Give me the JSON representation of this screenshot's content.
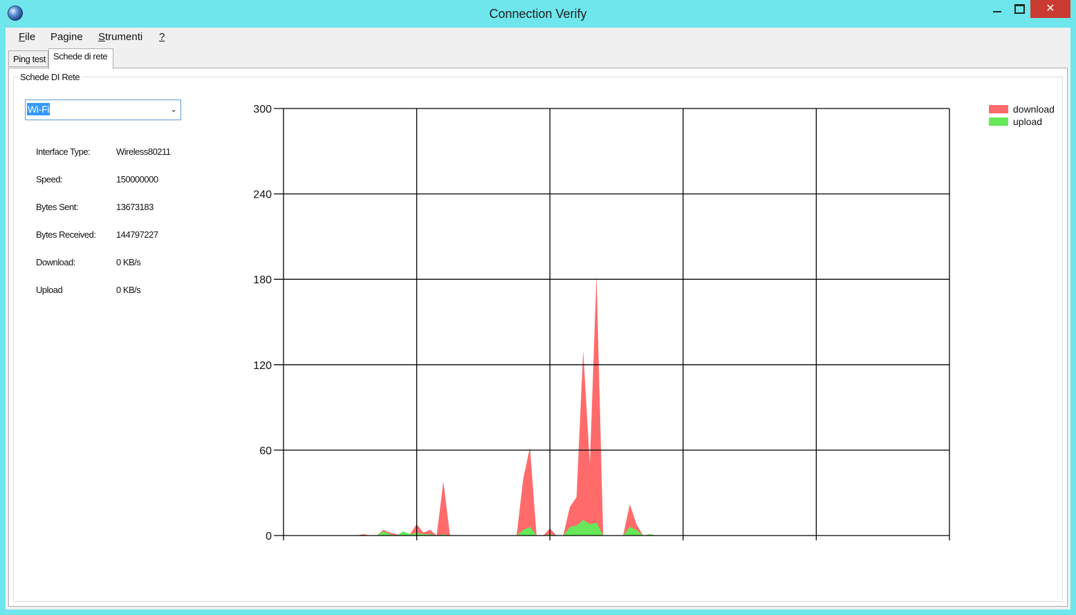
{
  "window": {
    "title": "Connection Verify",
    "close_glyph": "✕"
  },
  "menu": {
    "items": [
      {
        "label": "File",
        "underline": "F",
        "rest": "ile"
      },
      {
        "label": "Pagine",
        "underline": "",
        "rest": "Pagine"
      },
      {
        "label": "Strumenti",
        "underline": "S",
        "rest": "trumenti"
      },
      {
        "label": "?",
        "underline": "?",
        "rest": ""
      }
    ]
  },
  "tabs": [
    {
      "label": "Ping test",
      "active": false
    },
    {
      "label": "Schede di rete",
      "active": true
    }
  ],
  "group": {
    "title": "Schede DI Rete",
    "adapter_select": {
      "value": "Wi-Fi",
      "arrow": "⌄"
    },
    "info": [
      {
        "label": "Interface Type:",
        "value": "Wireless80211"
      },
      {
        "label": "Speed:",
        "value": "150000000"
      },
      {
        "label": "Bytes Sent:",
        "value": "13673183"
      },
      {
        "label": "Bytes Received:",
        "value": "144797227"
      },
      {
        "label": "Download:",
        "value": "0 KB/s"
      },
      {
        "label": "Upload",
        "value": "0 KB/s"
      }
    ]
  },
  "chart_data": {
    "type": "area",
    "title": "",
    "xlabel": "",
    "ylabel": "",
    "ylim": [
      0,
      300
    ],
    "yticks": [
      "0",
      "60",
      "120",
      "180",
      "240",
      "300"
    ],
    "grid": true,
    "legend": "top-right",
    "x": [
      0,
      1,
      2,
      3,
      4,
      5,
      6,
      7,
      8,
      9,
      10,
      11,
      12,
      13,
      14,
      15,
      16,
      17,
      18,
      19,
      20,
      21,
      22,
      23,
      24,
      25,
      26,
      27,
      28,
      29,
      30,
      31,
      32,
      33,
      34,
      35,
      36,
      37,
      38,
      39,
      40,
      41,
      42,
      43,
      44,
      45,
      46,
      47,
      48,
      49,
      50,
      51,
      52,
      53,
      54,
      55,
      56,
      57,
      58,
      59,
      60,
      61,
      62,
      63,
      64,
      65,
      66,
      67,
      68,
      69,
      70,
      71,
      72,
      73,
      74,
      75,
      76,
      77,
      78,
      79,
      80,
      81,
      82,
      83,
      84,
      85,
      86,
      87,
      88,
      89,
      90,
      91,
      92,
      93,
      94,
      95,
      96,
      97,
      98,
      99,
      100
    ],
    "xlim": [
      0,
      100
    ],
    "series": [
      {
        "name": "download",
        "color": "#ff6b6b",
        "values": [
          0,
          0,
          0,
          0,
          0,
          0,
          0,
          0,
          0,
          0,
          0,
          0,
          1,
          0,
          0,
          4,
          2,
          1,
          0,
          1,
          8,
          2,
          4,
          0,
          38,
          0,
          0,
          0,
          0,
          0,
          0,
          0,
          0,
          0,
          0,
          0,
          40,
          62,
          0,
          0,
          5,
          0,
          0,
          20,
          27,
          130,
          50,
          183,
          0,
          0,
          0,
          0,
          22,
          8,
          0,
          0,
          0,
          0,
          0,
          0,
          0,
          0,
          0,
          0,
          0,
          0,
          0,
          0,
          0,
          0,
          0,
          0,
          0,
          0,
          0,
          0,
          0,
          0,
          0,
          0,
          0,
          0,
          0,
          0,
          0,
          0,
          0,
          0,
          0,
          0,
          0,
          0,
          0,
          0,
          0,
          0,
          0,
          0,
          0,
          0,
          0
        ]
      },
      {
        "name": "upload",
        "color": "#66e85a",
        "values": [
          0,
          0,
          0,
          0,
          0,
          0,
          0,
          0,
          0,
          0,
          0,
          0,
          0,
          0,
          0,
          3,
          1,
          0,
          3,
          1,
          2,
          1,
          1,
          0,
          1,
          0,
          0,
          0,
          0,
          0,
          0,
          0,
          0,
          0,
          0,
          0,
          4,
          6,
          0,
          0,
          1,
          0,
          0,
          6,
          7,
          11,
          8,
          9,
          0,
          0,
          0,
          0,
          6,
          4,
          0,
          1,
          0,
          0,
          0,
          0,
          0,
          0,
          0,
          0,
          0,
          0,
          0,
          0,
          0,
          0,
          0,
          0,
          0,
          0,
          0,
          0,
          0,
          0,
          0,
          0,
          0,
          0,
          0,
          0,
          0,
          0,
          0,
          0,
          0,
          0,
          0,
          0,
          0,
          0,
          0,
          0,
          0,
          0,
          0,
          0,
          0
        ]
      }
    ]
  }
}
